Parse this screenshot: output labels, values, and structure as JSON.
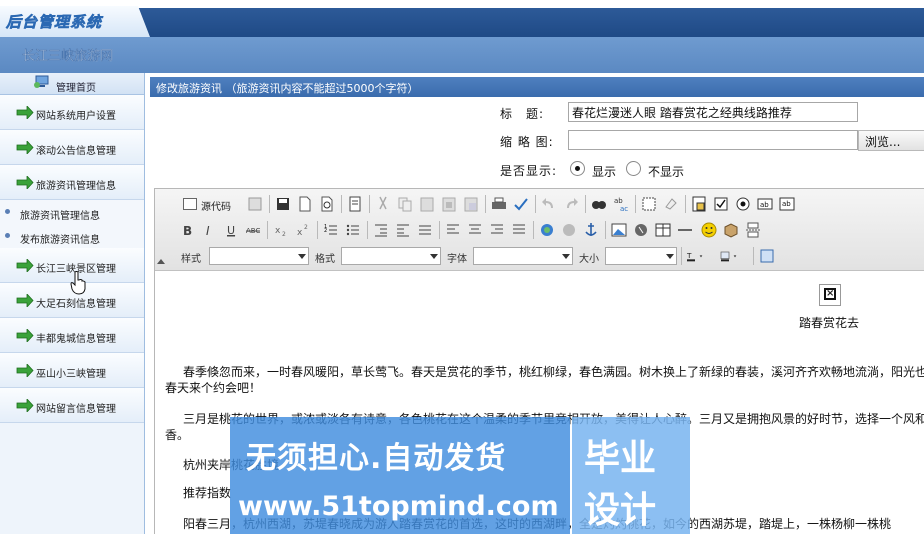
{
  "app": {
    "logo_text": "后台管理系统",
    "site_name": "长江三峡旅游网"
  },
  "sidebar": {
    "home_label": "管理首页",
    "items": [
      {
        "label": "网站系统用户设置"
      },
      {
        "label": "滚动公告信息管理"
      },
      {
        "label": "旅游资讯管理信息"
      }
    ],
    "sub_items": [
      {
        "label": "旅游资讯管理信息"
      },
      {
        "label": "发布旅游资讯信息"
      }
    ],
    "items_after": [
      {
        "label": "长江三峡景区管理"
      },
      {
        "label": "大足石刻信息管理"
      },
      {
        "label": "丰都鬼城信息管理"
      },
      {
        "label": "巫山小三峡管理"
      },
      {
        "label": "网站留言信息管理"
      }
    ]
  },
  "main": {
    "title": "修改旅游资讯 （旅游资讯内容不能超过5000个字符）",
    "form": {
      "title_label": "标　题:",
      "title_value": "春花烂漫迷人眼 踏春赏花之经典线路推荐",
      "thumb_label": "缩 略 图:",
      "thumb_value": "",
      "browse_label": "浏览...",
      "show_label": "是否显示:",
      "show_yes": "显示",
      "show_no": "不显示"
    }
  },
  "editor": {
    "source_label": "源代码",
    "style_label": "样式",
    "format_label": "格式",
    "font_label": "字体",
    "size_label": "大小",
    "image_caption": "踏春赏花去",
    "paragraphs": [
      "春季倏忽而来，一时春风暖阳，草长莺飞。春天是赏花的季节，桃红柳绿，春色满园。树木换上了新绿的春装，溪河齐齐欢畅地流淌，阳光也",
      "春天来个约会吧！",
      "三月是桃花的世界，或浓或淡各有诗意，各色桃花在这个温柔的季节里竞相开放，美得让人心醉。三月又是拥抱风景的好时节，选择一个风和",
      "香。",
      "杭州夹岸桃花胜境",
      "推荐指数",
      "阳春三月，杭州西湖，苏堤春晓成为游人踏春赏花的首选，这时的西湖畔，全是灼灼桃花，如今的西湖苏堤，踏堤上，一株杨柳一株桃"
    ]
  },
  "watermark": {
    "line1": "无须担心.自动发货",
    "line2": "www.51topmind.com",
    "box1": "毕业",
    "box2": "设计"
  },
  "colors": {
    "header_blue": "#2d5a98",
    "title_bar_blue": "#3a6cad",
    "sidebar_bg": "#eef4fb"
  }
}
